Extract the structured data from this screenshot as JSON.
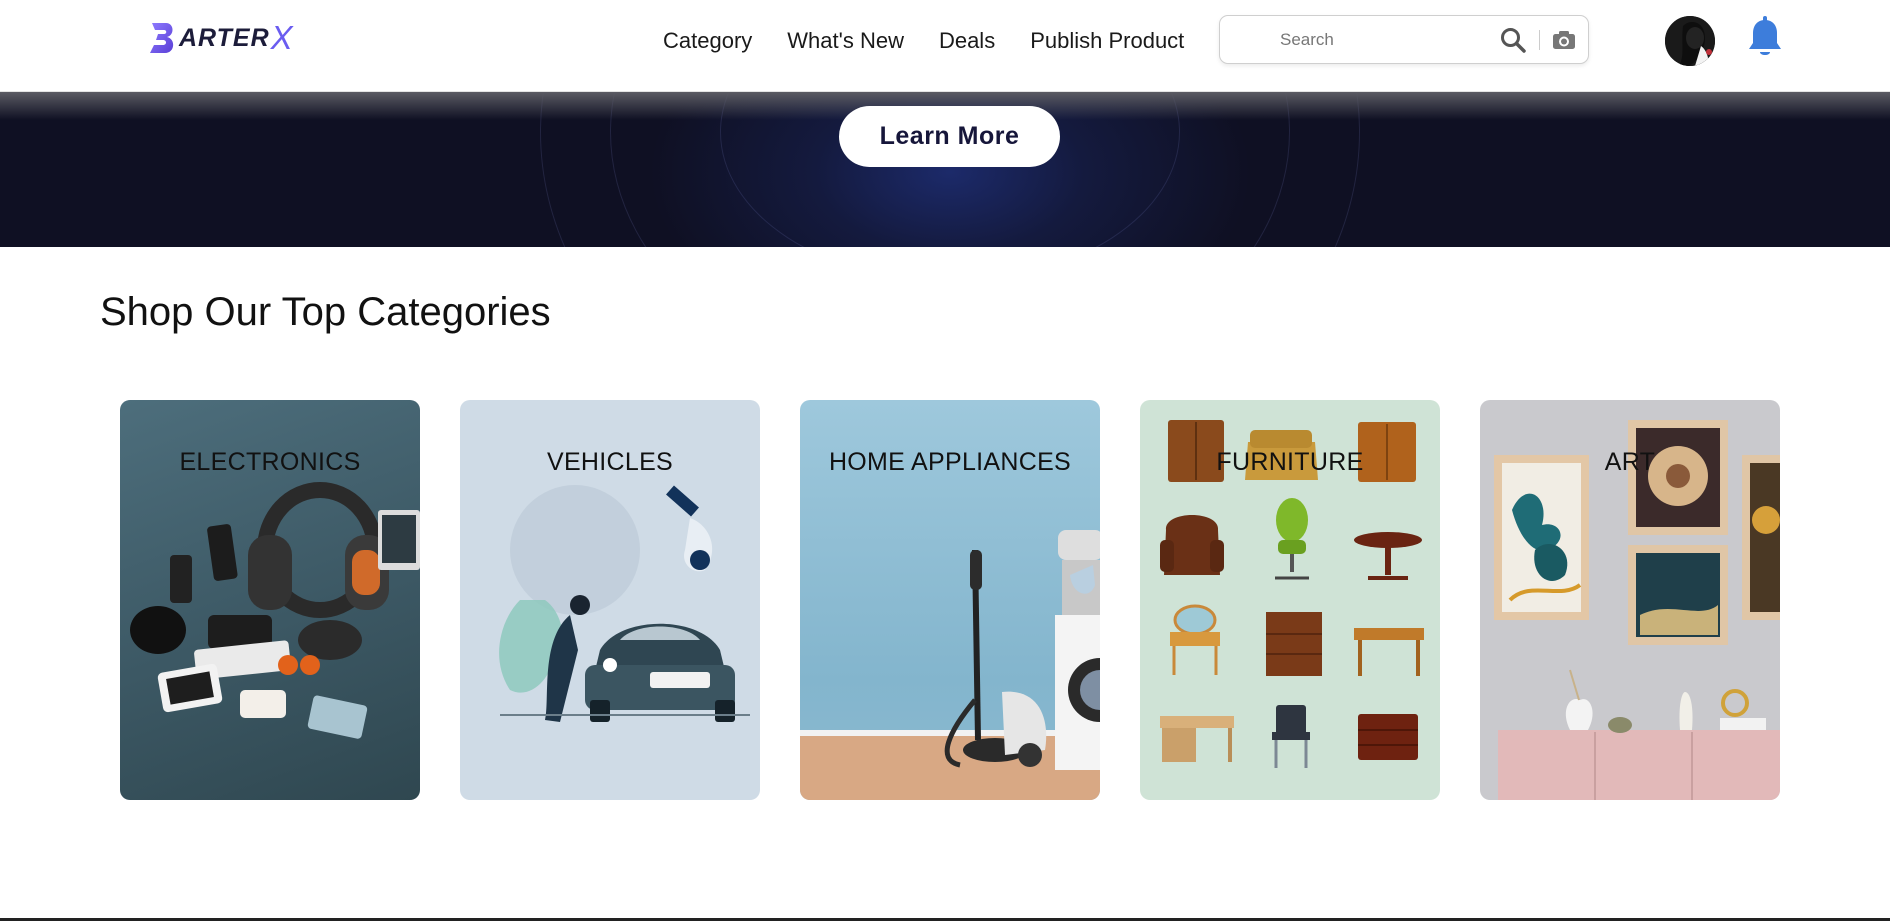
{
  "brand": {
    "logo_text": "ARTER",
    "logo_x": "X",
    "logo_letter": "B"
  },
  "nav": {
    "items": [
      {
        "label": "Category"
      },
      {
        "label": "What's New"
      },
      {
        "label": "Deals"
      },
      {
        "label": "Publish Product"
      }
    ]
  },
  "search": {
    "placeholder": "Search",
    "value": "",
    "search_icon": "search-icon",
    "camera_icon": "camera-icon"
  },
  "header_icons": {
    "avatar": "user-avatar",
    "notifications": "bell-icon"
  },
  "hero": {
    "button_label": "Learn More"
  },
  "categories": {
    "title": "Shop Our Top Categories",
    "items": [
      {
        "label": "ELECTRONICS"
      },
      {
        "label": "VEHICLES"
      },
      {
        "label": "HOME APPLIANCES"
      },
      {
        "label": "FURNITURE"
      },
      {
        "label": "ART"
      }
    ]
  },
  "colors": {
    "accent": "#6a5cf0",
    "hero_bg": "#0f1023",
    "bell": "#3d7ddb",
    "text": "#111111"
  }
}
